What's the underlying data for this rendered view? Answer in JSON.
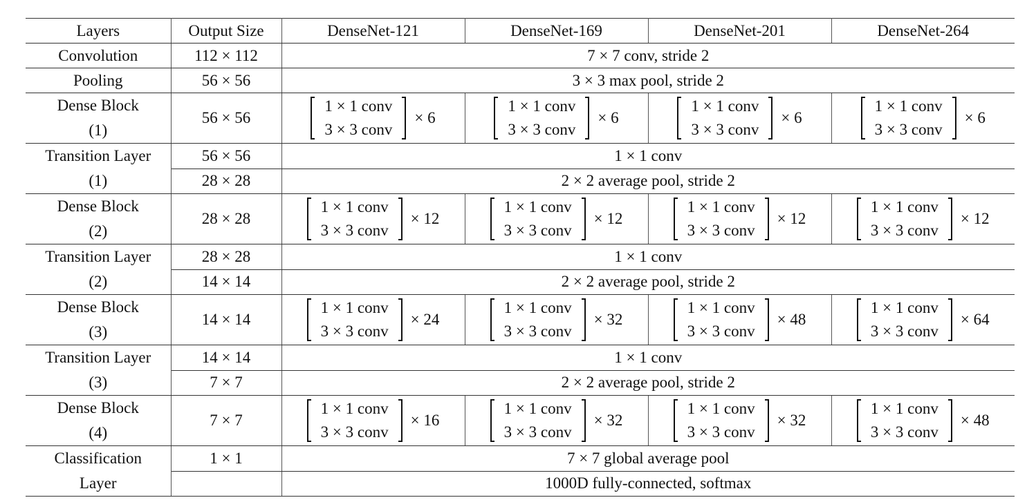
{
  "table": {
    "headers": [
      "Layers",
      "Output Size",
      "DenseNet-121",
      "DenseNet-169",
      "DenseNet-201",
      "DenseNet-264"
    ],
    "rows": {
      "convolution": {
        "layer": "Convolution",
        "output": "112 × 112",
        "spec": "7 × 7 conv, stride 2"
      },
      "pooling": {
        "layer": "Pooling",
        "output": "56 × 56",
        "spec": "3 × 3 max pool, stride 2"
      },
      "dense1": {
        "layer_line1": "Dense Block",
        "layer_line2": "(1)",
        "output": "56 × 56",
        "line1": "1 × 1 conv",
        "line2": "3 × 3 conv",
        "multipliers": [
          "× 6",
          "× 6",
          "× 6",
          "× 6"
        ]
      },
      "trans1": {
        "layer_line1": "Transition Layer",
        "layer_line2": "(1)",
        "output_a": "56 × 56",
        "spec_a": "1 × 1 conv",
        "output_b": "28 × 28",
        "spec_b": "2 × 2 average pool, stride 2"
      },
      "dense2": {
        "layer_line1": "Dense Block",
        "layer_line2": "(2)",
        "output": "28 × 28",
        "line1": "1 × 1 conv",
        "line2": "3 × 3 conv",
        "multipliers": [
          "× 12",
          "× 12",
          "× 12",
          "× 12"
        ]
      },
      "trans2": {
        "layer_line1": "Transition Layer",
        "layer_line2": "(2)",
        "output_a": "28 × 28",
        "spec_a": "1 × 1 conv",
        "output_b": "14 × 14",
        "spec_b": "2 × 2 average pool, stride 2"
      },
      "dense3": {
        "layer_line1": "Dense Block",
        "layer_line2": "(3)",
        "output": "14 × 14",
        "line1": "1 × 1 conv",
        "line2": "3 × 3 conv",
        "multipliers": [
          "× 24",
          "× 32",
          "× 48",
          "× 64"
        ]
      },
      "trans3": {
        "layer_line1": "Transition Layer",
        "layer_line2": "(3)",
        "output_a": "14 × 14",
        "spec_a": "1 × 1 conv",
        "output_b": "7 × 7",
        "spec_b": "2 × 2 average pool, stride 2"
      },
      "dense4": {
        "layer_line1": "Dense Block",
        "layer_line2": "(4)",
        "output": "7 × 7",
        "line1": "1 × 1 conv",
        "line2": "3 × 3 conv",
        "multipliers": [
          "× 16",
          "× 32",
          "× 32",
          "× 48"
        ]
      },
      "classification": {
        "layer_line1": "Classification",
        "layer_line2": "Layer",
        "output_a": "1 × 1",
        "spec_a": "7 × 7 global average pool",
        "output_b": "",
        "spec_b": "1000D fully-connected, softmax"
      }
    }
  }
}
